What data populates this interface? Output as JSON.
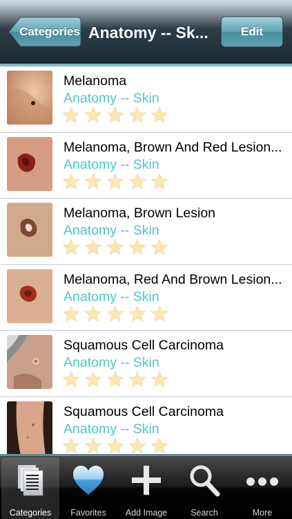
{
  "navbar": {
    "back_label": "Categories",
    "title": "Anatomy -- Sk...",
    "edit_label": "Edit"
  },
  "items": [
    {
      "title": "Melanoma",
      "category": "Anatomy -- Skin",
      "rating": 0,
      "thumb": "skin-mole-thumbnail"
    },
    {
      "title": "Melanoma, Brown And Red Lesion...",
      "category": "Anatomy -- Skin",
      "rating": 0,
      "thumb": "red-lesion-thumbnail"
    },
    {
      "title": "Melanoma, Brown Lesion",
      "category": "Anatomy -- Skin",
      "rating": 0,
      "thumb": "brown-lesion-thumbnail"
    },
    {
      "title": "Melanoma, Red And Brown Lesion...",
      "category": "Anatomy -- Skin",
      "rating": 0,
      "thumb": "red-brown-lesion-thumbnail"
    },
    {
      "title": "Squamous Cell Carcinoma",
      "category": "Anatomy -- Skin",
      "rating": 0,
      "thumb": "face-carcinoma-thumbnail"
    },
    {
      "title": "Squamous Cell Carcinoma",
      "category": "Anatomy -- Skin",
      "rating": 0,
      "thumb": "arm-carcinoma-thumbnail"
    }
  ],
  "tabbar": {
    "tabs": [
      {
        "label": "Categories",
        "icon": "documents-icon",
        "selected": true
      },
      {
        "label": "Favorites",
        "icon": "heart-icon",
        "selected": false
      },
      {
        "label": "Add Image",
        "icon": "plus-icon",
        "selected": false
      },
      {
        "label": "Search",
        "icon": "magnifier-icon",
        "selected": false
      },
      {
        "label": "More",
        "icon": "more-dots-icon",
        "selected": false
      }
    ]
  },
  "colors": {
    "category_text": "#53c4c8",
    "star_fill": "#fbe7b4",
    "accent": "#5fa2b1"
  }
}
